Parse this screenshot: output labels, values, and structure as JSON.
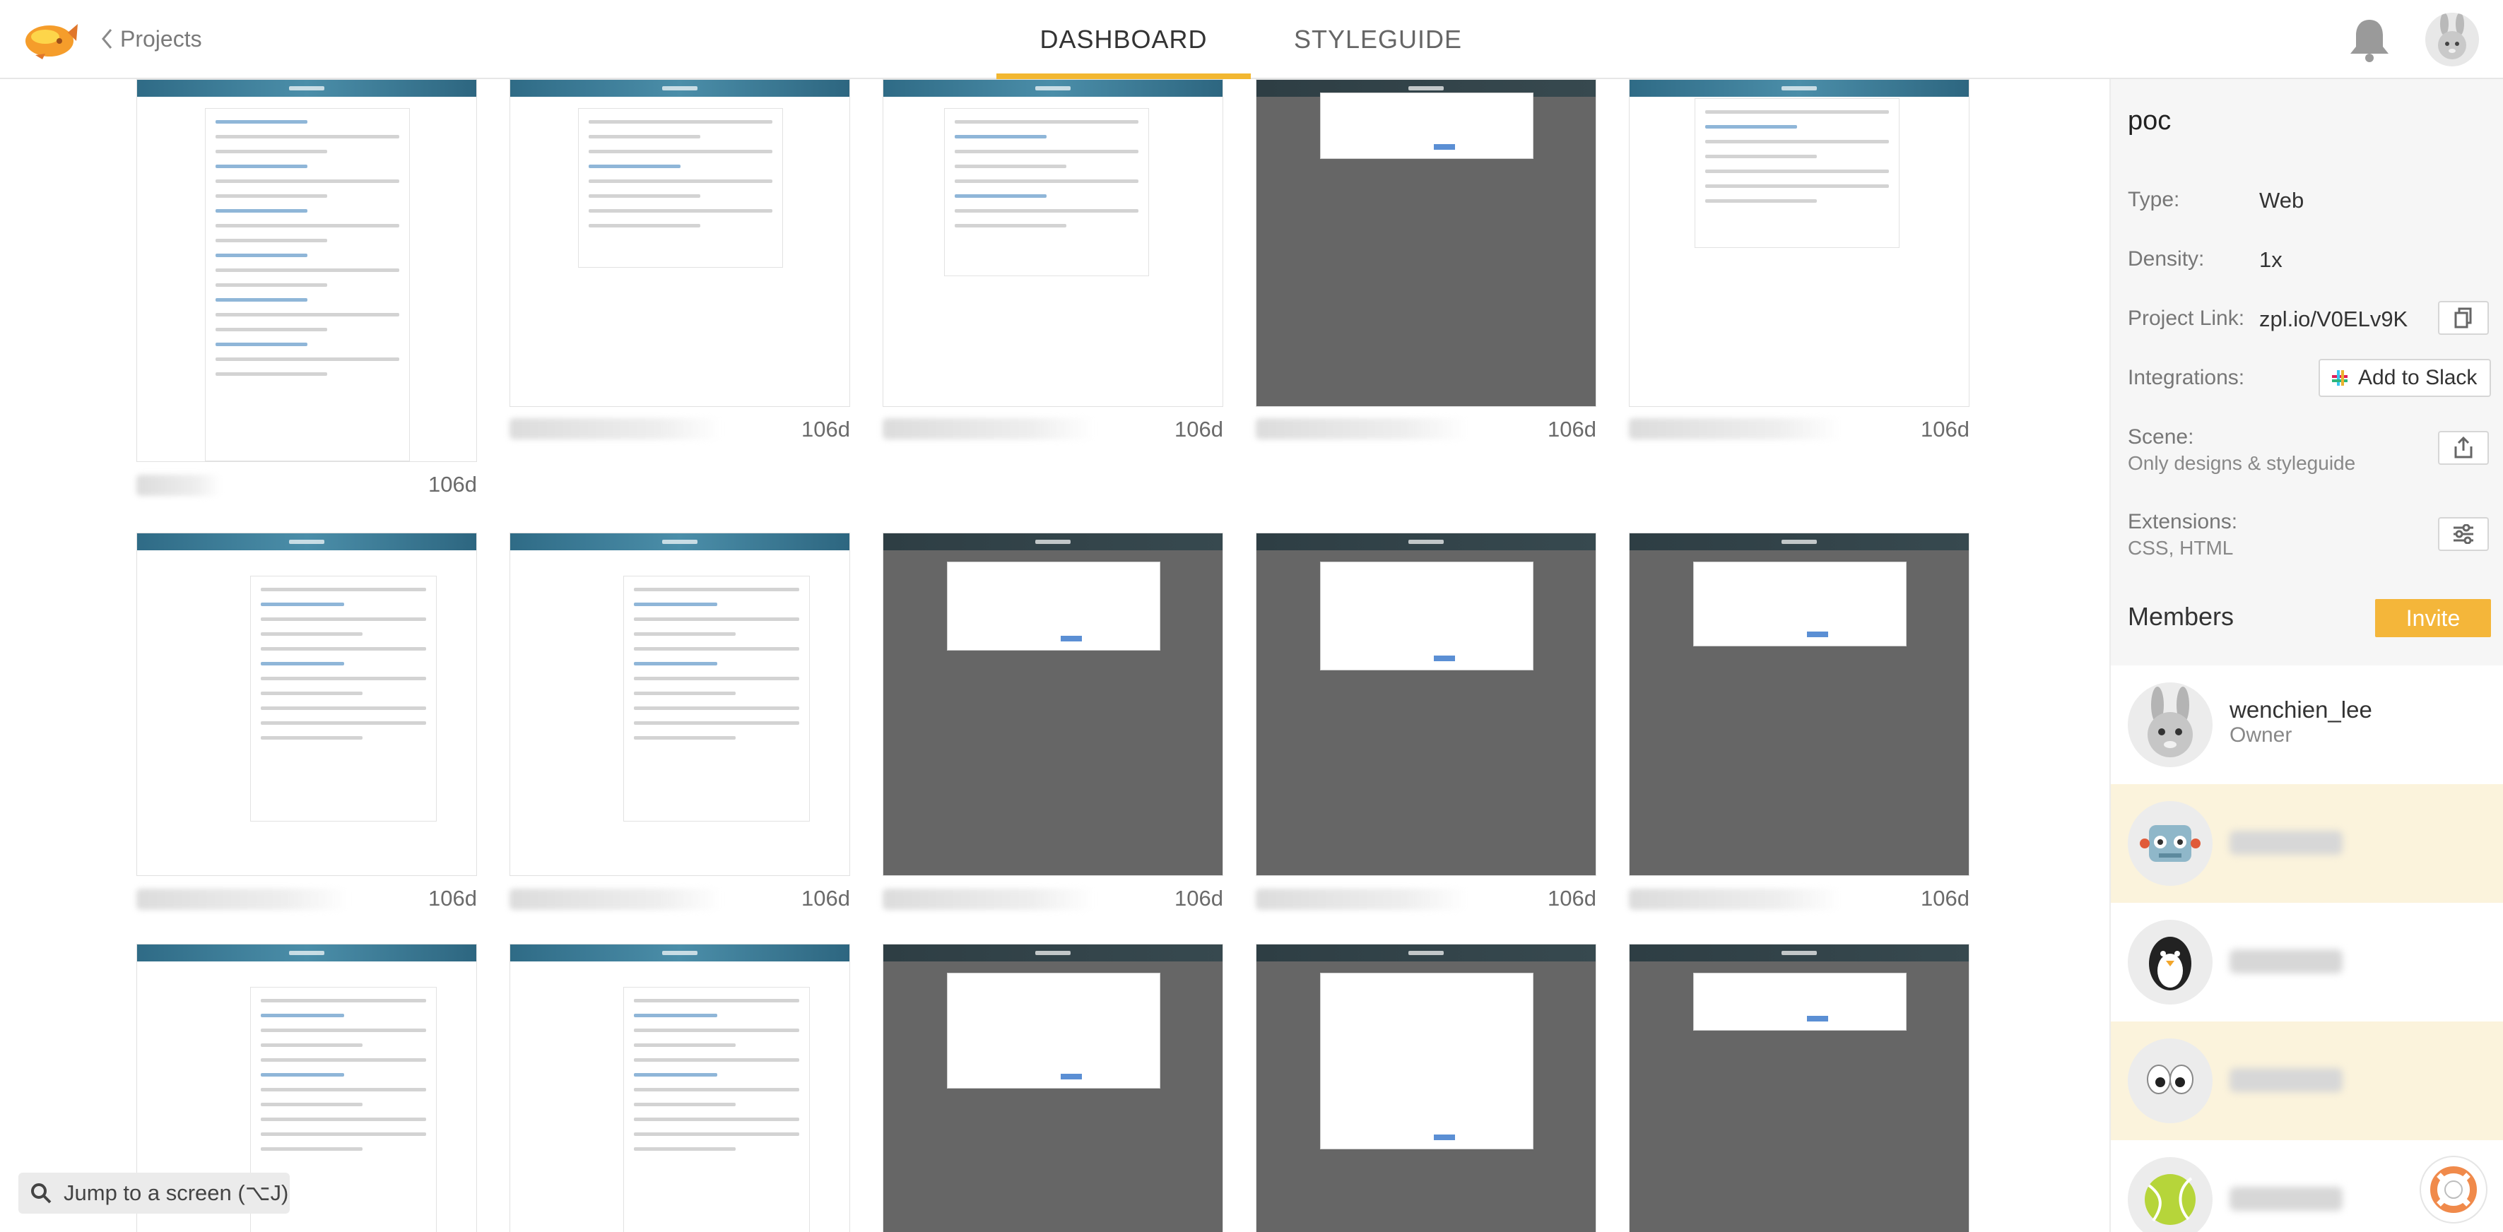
{
  "header": {
    "back_label": "Projects",
    "tabs": [
      {
        "label": "DASHBOARD",
        "active": true
      },
      {
        "label": "STYLEGUIDE",
        "active": false
      }
    ],
    "accent_color": "#f2b731"
  },
  "screens": {
    "age_label": "106d"
  },
  "jump": {
    "label": "Jump to a screen (⌥J)"
  },
  "project": {
    "name": "poc",
    "type_label": "Type:",
    "type_value": "Web",
    "density_label": "Density:",
    "density_value": "1x",
    "link_label": "Project Link:",
    "link_value": "zpl.io/V0ELv9K",
    "integrations_label": "Integrations:",
    "slack_button": "Add to Slack",
    "scene_label": "Scene:",
    "scene_value": "Only designs & styleguide",
    "extensions_label": "Extensions:",
    "extensions_value": "CSS, HTML"
  },
  "members": {
    "title": "Members",
    "invite_label": "Invite",
    "invite_color": "#f4b63a",
    "list": [
      {
        "name": "wenchien_lee",
        "role": "Owner",
        "avatar": "rabbit-avatar"
      },
      {
        "avatar": "robot-avatar"
      },
      {
        "avatar": "penguin-avatar"
      },
      {
        "avatar": "eyes-avatar"
      },
      {
        "avatar": "tennis-ball-avatar"
      }
    ]
  }
}
